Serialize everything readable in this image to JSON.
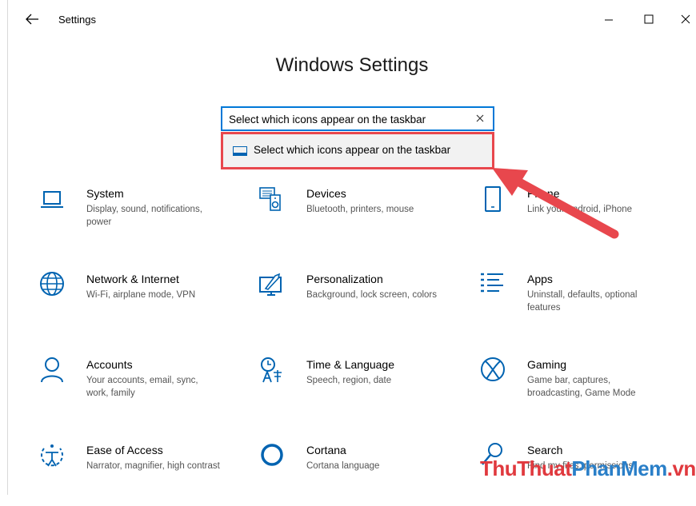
{
  "window": {
    "title": "Settings",
    "back_icon": "back-arrow-icon",
    "controls": [
      "minimize-icon",
      "maximize-icon",
      "close-icon"
    ]
  },
  "heading": "Windows Settings",
  "search": {
    "value": "Select which icons appear on the taskbar",
    "clear_icon": "clear-icon"
  },
  "suggestion": {
    "label": "Select which icons appear on the taskbar",
    "icon": "taskbar-icon",
    "highlight_color": "#e8474d"
  },
  "tiles": [
    {
      "title": "System",
      "desc": "Display, sound, notifications, power",
      "icon": "laptop-icon"
    },
    {
      "title": "Devices",
      "desc": "Bluetooth, printers, mouse",
      "icon": "devices-icon"
    },
    {
      "title": "Phone",
      "desc": "Link your Android, iPhone",
      "icon": "phone-icon"
    },
    {
      "title": "Network & Internet",
      "desc": "Wi-Fi, airplane mode, VPN",
      "icon": "globe-icon"
    },
    {
      "title": "Personalization",
      "desc": "Background, lock screen, colors",
      "icon": "personalization-icon"
    },
    {
      "title": "Apps",
      "desc": "Uninstall, defaults, optional features",
      "icon": "apps-list-icon"
    },
    {
      "title": "Accounts",
      "desc": "Your accounts, email, sync, work, family",
      "icon": "person-icon"
    },
    {
      "title": "Time & Language",
      "desc": "Speech, region, date",
      "icon": "time-language-icon"
    },
    {
      "title": "Gaming",
      "desc": "Game bar, captures, broadcasting, Game Mode",
      "icon": "xbox-icon"
    },
    {
      "title": "Ease of Access",
      "desc": "Narrator, magnifier, high contrast",
      "icon": "ease-of-access-icon"
    },
    {
      "title": "Cortana",
      "desc": "Cortana language",
      "icon": "cortana-icon"
    },
    {
      "title": "Search",
      "desc": "Find my files, permissions",
      "icon": "search-icon"
    }
  ],
  "annotation": {
    "icon": "red-arrow-icon",
    "color": "#e8474d"
  },
  "watermark": {
    "part1": "ThuThuat",
    "part2": "PhanMem",
    "part3": ".vn"
  },
  "colors": {
    "accent": "#0078d7",
    "highlight": "#e8474d"
  }
}
